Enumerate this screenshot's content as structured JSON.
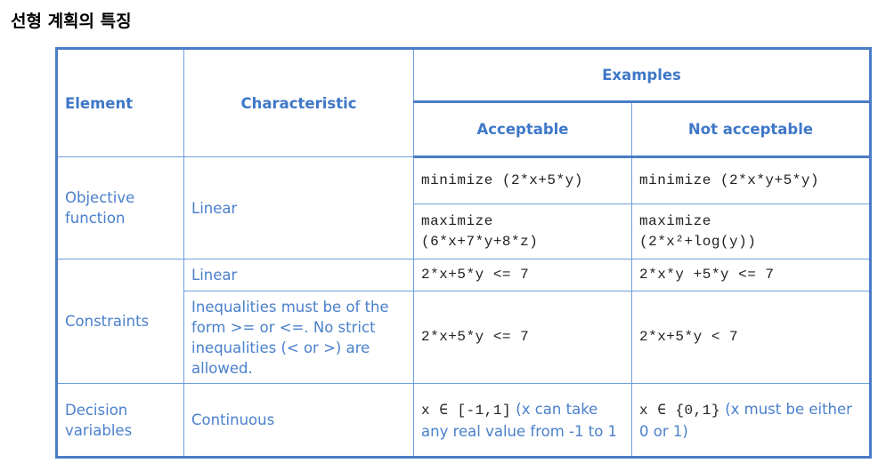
{
  "title": "선형 계획의 특징",
  "headers": {
    "element": "Element",
    "characteristic": "Characteristic",
    "examples": "Examples",
    "acceptable": "Acceptable",
    "not_acceptable": "Not acceptable"
  },
  "rows": {
    "objective": {
      "element": "Objective function",
      "characteristic": "Linear",
      "ex1_ok": "minimize (2*x+5*y)",
      "ex1_bad": "minimize (2*x*y+5*y)",
      "ex2_ok_a": "maximize",
      "ex2_ok_b": "(6*x+7*y+8*z)",
      "ex2_bad_a": "maximize",
      "ex2_bad_b": "(2*x²+log(y))"
    },
    "constraints": {
      "element": "Constraints",
      "char1": "Linear",
      "ex1_ok": "2*x+5*y <= 7",
      "ex1_bad": "2*x*y +5*y <= 7",
      "char2": "Inequalities must be of the form >= or <=. No strict inequalities (< or >) are allowed.",
      "ex2_ok": "2*x+5*y <= 7",
      "ex2_bad": "2*x+5*y < 7"
    },
    "decision": {
      "element": "Decision variables",
      "characteristic": "Continuous",
      "ok_code": "x ∈ [-1,1]",
      "ok_note": " (x can take any real value from -1 to 1",
      "bad_code": "x ∈ {0,1}",
      "bad_note": " (x must be either 0 or 1)"
    }
  }
}
